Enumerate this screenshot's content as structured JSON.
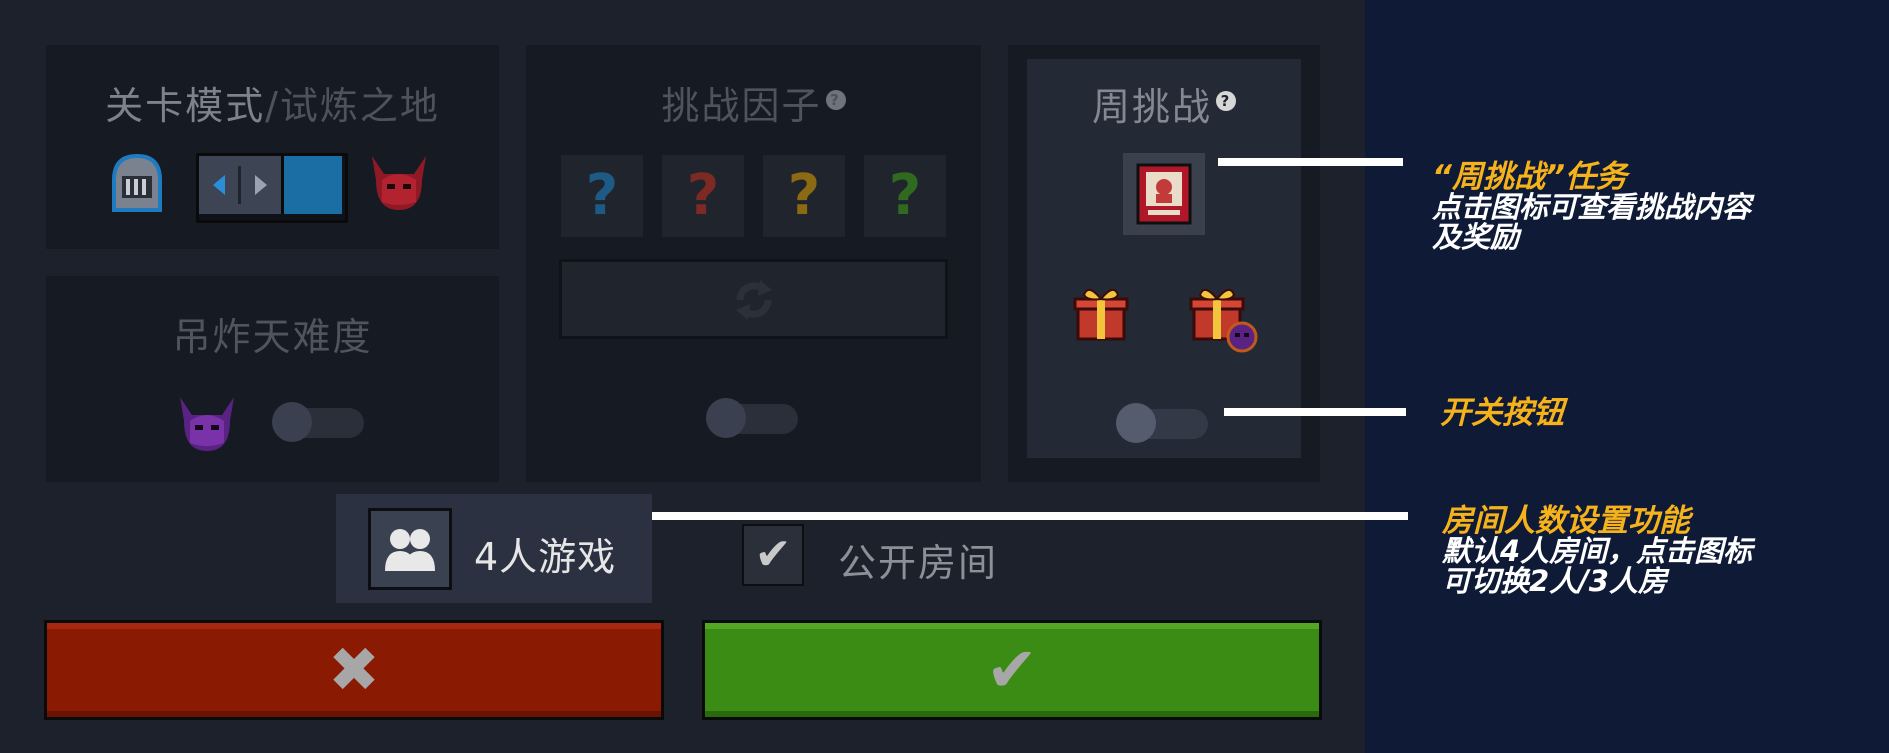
{
  "level_mode": {
    "title": "关卡模式",
    "separator": "/",
    "subtitle": "试炼之地"
  },
  "difficulty": {
    "title": "吊炸天难度"
  },
  "challenge_factors": {
    "title": "挑战因子",
    "help_icon": "?",
    "slots": [
      {
        "icon": "?",
        "color": "#1d5a85"
      },
      {
        "icon": "?",
        "color": "#7d2a24"
      },
      {
        "icon": "?",
        "color": "#8c6a14"
      },
      {
        "icon": "?",
        "color": "#2f6a20"
      }
    ],
    "refresh_icon": "refresh-icon"
  },
  "weekly_challenge": {
    "title": "周挑战",
    "help_icon": "?"
  },
  "players": {
    "label": "4人游戏"
  },
  "public_room": {
    "label": "公开房间",
    "checkmark": "✔"
  },
  "actions": {
    "cancel_symbol": "✖",
    "confirm_symbol": "✔"
  },
  "annotations": [
    {
      "highlight": "“周挑战”任务",
      "lines": [
        "点击图标可查看挑战内容",
        "及奖励"
      ]
    },
    {
      "highlight": "开关按钮",
      "lines": []
    },
    {
      "highlight": "房间人数设置功能",
      "lines": [
        "默认4人房间，点击图标",
        "可切换2人/3人房"
      ]
    }
  ],
  "colors": {
    "cancel": "#8a1a02",
    "confirm": "#3b8c14",
    "accent_yellow": "#f6b21b",
    "slider_blue": "#1a6ea3"
  }
}
